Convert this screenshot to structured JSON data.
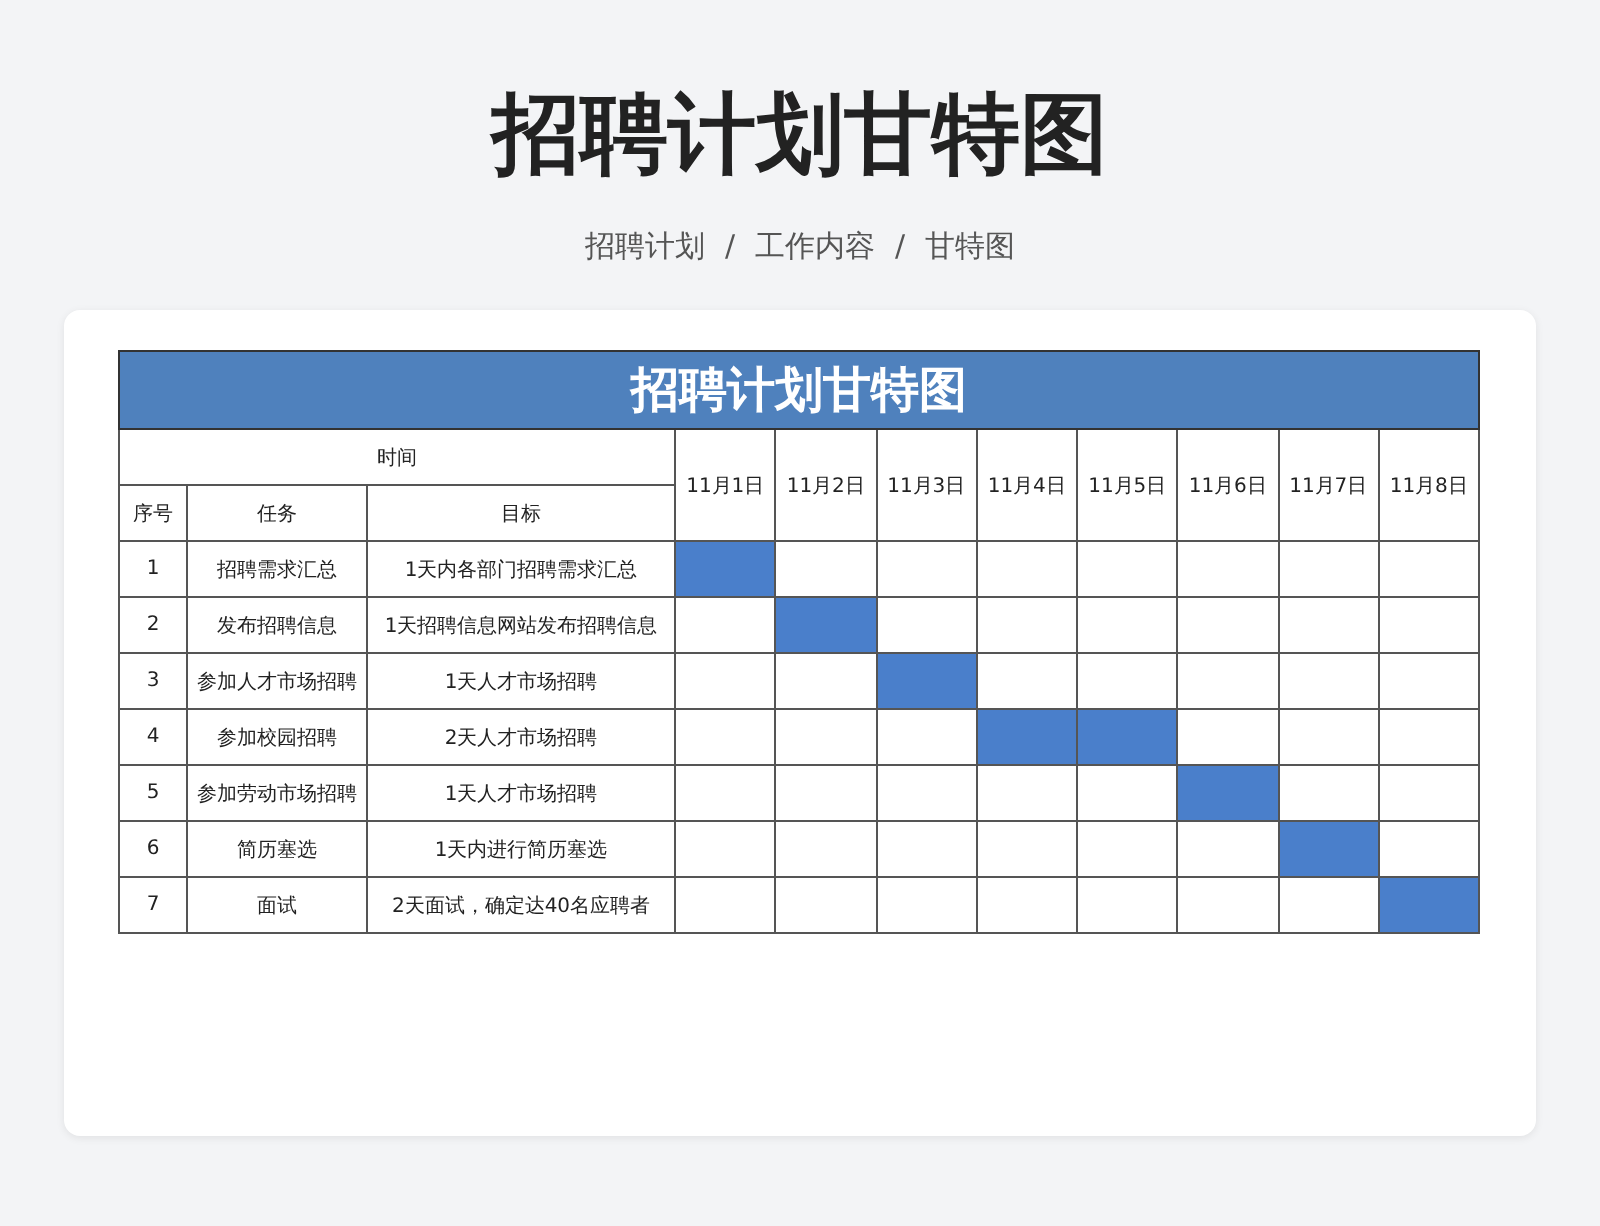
{
  "page_title": "招聘计划甘特图",
  "breadcrumb": [
    "招聘计划",
    "工作内容",
    "甘特图"
  ],
  "breadcrumb_separator": "/",
  "table": {
    "title": "招聘计划甘特图",
    "time_header": "时间",
    "columns": [
      "序号",
      "任务",
      "目标"
    ],
    "dates": [
      "11月1日",
      "11月2日",
      "11月3日",
      "11月4日",
      "11月5日",
      "11月6日",
      "11月7日",
      "11月8日"
    ],
    "rows": [
      {
        "no": "1",
        "task": "招聘需求汇总",
        "goal": "1天内各部门招聘需求汇总",
        "filled": [
          true,
          false,
          false,
          false,
          false,
          false,
          false,
          false
        ]
      },
      {
        "no": "2",
        "task": "发布招聘信息",
        "goal": "1天招聘信息网站发布招聘信息",
        "filled": [
          false,
          true,
          false,
          false,
          false,
          false,
          false,
          false
        ]
      },
      {
        "no": "3",
        "task": "参加人才市场招聘",
        "goal": "1天人才市场招聘",
        "filled": [
          false,
          false,
          true,
          false,
          false,
          false,
          false,
          false
        ]
      },
      {
        "no": "4",
        "task": "参加校园招聘",
        "goal": "2天人才市场招聘",
        "filled": [
          false,
          false,
          false,
          true,
          true,
          false,
          false,
          false
        ]
      },
      {
        "no": "5",
        "task": "参加劳动市场招聘",
        "goal": "1天人才市场招聘",
        "filled": [
          false,
          false,
          false,
          false,
          false,
          true,
          false,
          false
        ]
      },
      {
        "no": "6",
        "task": "简历塞选",
        "goal": "1天内进行简历塞选",
        "filled": [
          false,
          false,
          false,
          false,
          false,
          false,
          true,
          false
        ]
      },
      {
        "no": "7",
        "task": "面试",
        "goal": "2天面试，确定达40名应聘者",
        "filled": [
          false,
          false,
          false,
          false,
          false,
          false,
          false,
          true
        ]
      }
    ]
  }
}
